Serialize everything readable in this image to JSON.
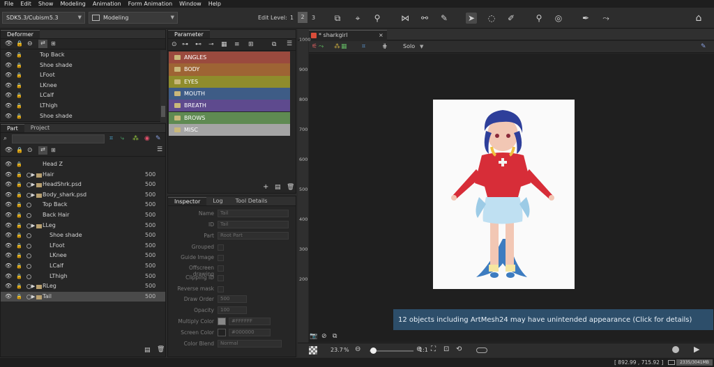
{
  "menu": [
    "File",
    "Edit",
    "Show",
    "Modeling",
    "Animation",
    "Form Animation",
    "Window",
    "Help"
  ],
  "toolbar": {
    "sdk_select": "SDK5.3/Cubism5.3",
    "mode_select": "Modeling",
    "edit_level_label": "Edit Level:",
    "edit_levels": [
      "1",
      "2",
      "3"
    ],
    "active_level": "2"
  },
  "deformer": {
    "tab": "Deformer",
    "rows": [
      "Top Back",
      "Shoe shade",
      "LFoot",
      "LKnee",
      "LCalf",
      "LThigh",
      "Shoe shade"
    ]
  },
  "parts": {
    "tabs": [
      "Part",
      "Project"
    ],
    "rows": [
      {
        "name": "Head Z",
        "value": ""
      },
      {
        "name": "Hair",
        "value": "500"
      },
      {
        "name": "HeadShrk.psd",
        "value": "500"
      },
      {
        "name": "Body_shark.psd",
        "value": "500"
      },
      {
        "name": "Top Back",
        "value": "500"
      },
      {
        "name": "Back Hair",
        "value": "500"
      },
      {
        "name": "LLeg",
        "value": "500"
      },
      {
        "name": "Shoe shade",
        "value": "500"
      },
      {
        "name": "LFoot",
        "value": "500"
      },
      {
        "name": "LKnee",
        "value": "500"
      },
      {
        "name": "LCalf",
        "value": "500"
      },
      {
        "name": "LThigh",
        "value": "500"
      },
      {
        "name": "RLeg",
        "value": "500"
      },
      {
        "name": "Tail",
        "value": "500"
      }
    ]
  },
  "parameter": {
    "tab": "Parameter",
    "groups": [
      {
        "name": "ANGLES",
        "color": "#9a4a3e"
      },
      {
        "name": "BODY",
        "color": "#9e6434"
      },
      {
        "name": "EYES",
        "color": "#8f8c2c"
      },
      {
        "name": "MOUTH",
        "color": "#3e5c86"
      },
      {
        "name": "BREATH",
        "color": "#5e4a8e"
      },
      {
        "name": "BROWS",
        "color": "#5f8a52"
      },
      {
        "name": "MISC",
        "color": "#a4a4a4"
      }
    ]
  },
  "inspector": {
    "tabs": [
      "Inspector",
      "Log",
      "Tool Details"
    ],
    "fields": [
      {
        "label": "Name",
        "value": "Tail"
      },
      {
        "label": "ID",
        "value": "Tail"
      },
      {
        "label": "Part",
        "value": "Root Part"
      },
      {
        "label": "Grouped",
        "value": ""
      },
      {
        "label": "Guide Image",
        "value": ""
      },
      {
        "label": "Offscreen drawing",
        "value": ""
      },
      {
        "label": "Clipping ID",
        "value": ""
      },
      {
        "label": "Reverse mask",
        "value": ""
      },
      {
        "label": "Draw Order",
        "value": "500"
      },
      {
        "label": "Opacity",
        "value": "100"
      },
      {
        "label": "Multiply Color",
        "value": "#FFFFFF"
      },
      {
        "label": "Screen Color",
        "value": "#000000"
      },
      {
        "label": "Color Blend",
        "value": "Normal"
      }
    ]
  },
  "viewer": {
    "doc_tab": "* sharkgirl",
    "solo_label": "Solo",
    "ruler_ticks": [
      "1000",
      "900",
      "800",
      "700",
      "600",
      "500",
      "400",
      "300",
      "200"
    ],
    "notification": "12 objects including ArtMesh24 may have unintended appearance (Click for details)",
    "zoom": "23.7",
    "zoom_unit": "%",
    "ratio": "1:1"
  },
  "status": {
    "coords": "[ 892.99 , 715.92 ]",
    "memory": "2335/3041MB"
  },
  "colors": {
    "accent": "#3c8fd8",
    "notice_bg": "#2d4e6a"
  }
}
